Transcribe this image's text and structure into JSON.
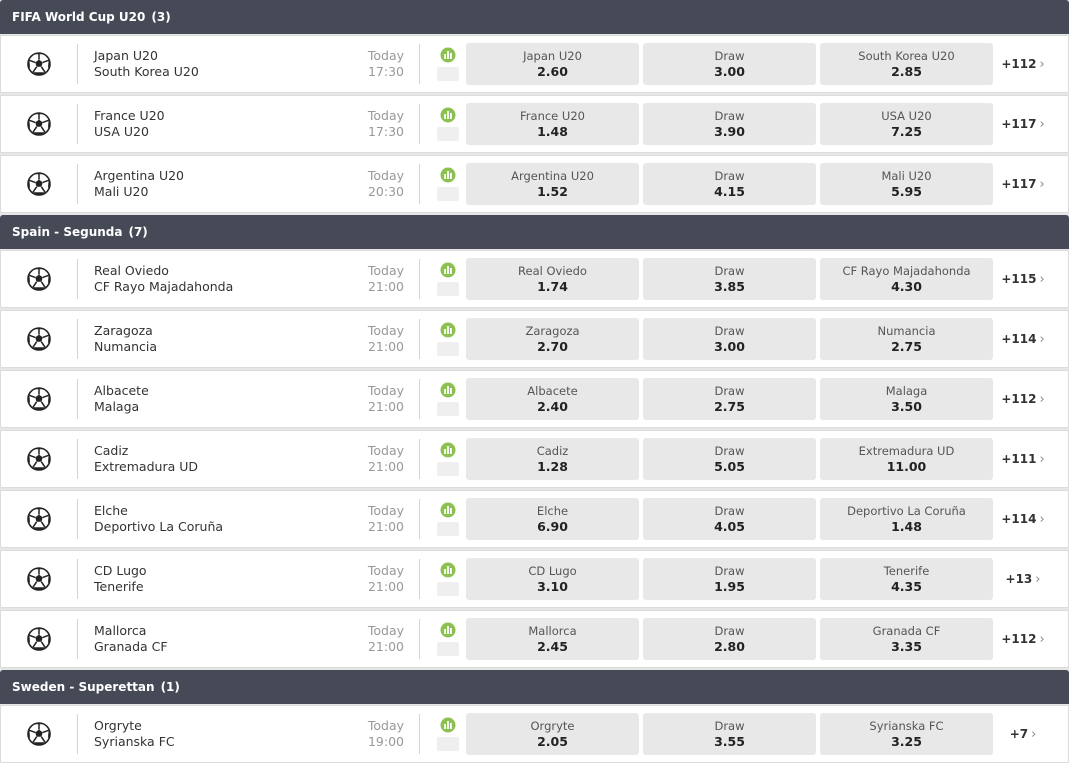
{
  "leagues": [
    {
      "name": "FIFA World Cup U20",
      "count": "(3)",
      "matches": [
        {
          "home": "Japan U20",
          "away": "South Korea U20",
          "day": "Today",
          "time": "17:30",
          "odds": [
            {
              "label": "Japan U20",
              "price": "2.60"
            },
            {
              "label": "Draw",
              "price": "3.00"
            },
            {
              "label": "South Korea U20",
              "price": "2.85"
            }
          ],
          "more": "+112"
        },
        {
          "home": "France U20",
          "away": "USA U20",
          "day": "Today",
          "time": "17:30",
          "odds": [
            {
              "label": "France U20",
              "price": "1.48"
            },
            {
              "label": "Draw",
              "price": "3.90"
            },
            {
              "label": "USA U20",
              "price": "7.25"
            }
          ],
          "more": "+117"
        },
        {
          "home": "Argentina U20",
          "away": "Mali U20",
          "day": "Today",
          "time": "20:30",
          "odds": [
            {
              "label": "Argentina U20",
              "price": "1.52"
            },
            {
              "label": "Draw",
              "price": "4.15"
            },
            {
              "label": "Mali U20",
              "price": "5.95"
            }
          ],
          "more": "+117"
        }
      ]
    },
    {
      "name": "Spain - Segunda",
      "count": "(7)",
      "matches": [
        {
          "home": "Real Oviedo",
          "away": "CF Rayo Majadahonda",
          "day": "Today",
          "time": "21:00",
          "odds": [
            {
              "label": "Real Oviedo",
              "price": "1.74"
            },
            {
              "label": "Draw",
              "price": "3.85"
            },
            {
              "label": "CF Rayo Majadahonda",
              "price": "4.30"
            }
          ],
          "more": "+115"
        },
        {
          "home": "Zaragoza",
          "away": "Numancia",
          "day": "Today",
          "time": "21:00",
          "odds": [
            {
              "label": "Zaragoza",
              "price": "2.70"
            },
            {
              "label": "Draw",
              "price": "3.00"
            },
            {
              "label": "Numancia",
              "price": "2.75"
            }
          ],
          "more": "+114"
        },
        {
          "home": "Albacete",
          "away": "Malaga",
          "day": "Today",
          "time": "21:00",
          "odds": [
            {
              "label": "Albacete",
              "price": "2.40"
            },
            {
              "label": "Draw",
              "price": "2.75"
            },
            {
              "label": "Malaga",
              "price": "3.50"
            }
          ],
          "more": "+112"
        },
        {
          "home": "Cadiz",
          "away": "Extremadura UD",
          "day": "Today",
          "time": "21:00",
          "odds": [
            {
              "label": "Cadiz",
              "price": "1.28"
            },
            {
              "label": "Draw",
              "price": "5.05"
            },
            {
              "label": "Extremadura UD",
              "price": "11.00"
            }
          ],
          "more": "+111"
        },
        {
          "home": "Elche",
          "away": "Deportivo La Coruña",
          "day": "Today",
          "time": "21:00",
          "odds": [
            {
              "label": "Elche",
              "price": "6.90"
            },
            {
              "label": "Draw",
              "price": "4.05"
            },
            {
              "label": "Deportivo La Coruña",
              "price": "1.48"
            }
          ],
          "more": "+114"
        },
        {
          "home": "CD Lugo",
          "away": "Tenerife",
          "day": "Today",
          "time": "21:00",
          "odds": [
            {
              "label": "CD Lugo",
              "price": "3.10"
            },
            {
              "label": "Draw",
              "price": "1.95"
            },
            {
              "label": "Tenerife",
              "price": "4.35"
            }
          ],
          "more": "+13"
        },
        {
          "home": "Mallorca",
          "away": "Granada CF",
          "day": "Today",
          "time": "21:00",
          "odds": [
            {
              "label": "Mallorca",
              "price": "2.45"
            },
            {
              "label": "Draw",
              "price": "2.80"
            },
            {
              "label": "Granada CF",
              "price": "3.35"
            }
          ],
          "more": "+112"
        }
      ]
    },
    {
      "name": "Sweden - Superettan",
      "count": "(1)",
      "matches": [
        {
          "home": "Orgryte",
          "away": "Syrianska FC",
          "day": "Today",
          "time": "19:00",
          "odds": [
            {
              "label": "Orgryte",
              "price": "2.05"
            },
            {
              "label": "Draw",
              "price": "3.55"
            },
            {
              "label": "Syrianska FC",
              "price": "3.25"
            }
          ],
          "more": "+7"
        }
      ]
    }
  ],
  "icons": {
    "sport": "soccer-ball-icon",
    "stats": "stats-chart-icon",
    "more": "chevron-right-icon"
  },
  "colors": {
    "header_bg": "#454a56",
    "odd_bg": "#e8e8e8",
    "stats_green": "#8cc152"
  }
}
